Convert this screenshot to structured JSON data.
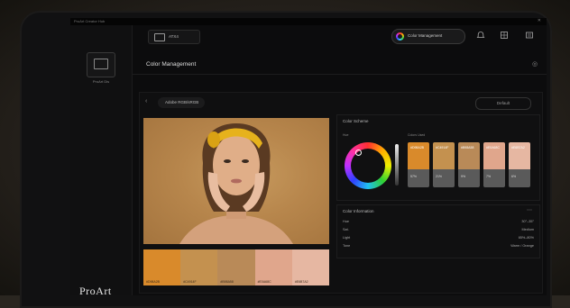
{
  "window": {
    "title": "ProArt Creator Hub",
    "close": "✕"
  },
  "sidebar": {
    "monitor_label": "ProArt Dis"
  },
  "header": {
    "device_label": "ATX4",
    "calibration_label": "Color Management",
    "icons": [
      "bell-icon",
      "grid-icon",
      "menu-icon"
    ]
  },
  "page": {
    "title": "Color Management",
    "title_icon": "◎"
  },
  "preset": {
    "tab_label": "Adobe RGB/sRGB",
    "button_label": "Default"
  },
  "palette_strip": [
    {
      "color": "#d98a2b",
      "label": "#D98A2B"
    },
    {
      "color": "#c4914f",
      "label": "#C4914F"
    },
    {
      "color": "#b98a58",
      "label": "#B98A58"
    },
    {
      "color": "#e0a68c",
      "label": "#E0A68C"
    },
    {
      "color": "#e6b7a2",
      "label": "#E6B7A2"
    }
  ],
  "color_card": {
    "title": "Color Scheme",
    "wheel_label": "Hue",
    "palette_label": "Colors Used",
    "swatches": [
      {
        "color": "#d98a2b",
        "label": "#D98A2B",
        "value": "57%"
      },
      {
        "color": "#c4914f",
        "label": "#C4914F",
        "value": "21%"
      },
      {
        "color": "#b98a58",
        "label": "#B98A58",
        "value": "9%"
      },
      {
        "color": "#e0a68c",
        "label": "#E0A68C",
        "value": "7%"
      },
      {
        "color": "#e6b7a2",
        "label": "#E6B7A2",
        "value": "6%"
      }
    ]
  },
  "info_card": {
    "title": "Color Information",
    "ctl": "⋯",
    "rows": [
      {
        "k": "Hue",
        "v": "30°–35°"
      },
      {
        "k": "Sat.",
        "v": "Medium"
      },
      {
        "k": "Light",
        "v": "65%–80%"
      },
      {
        "k": "Tone",
        "v": "Warm / Orange"
      }
    ]
  },
  "brand": "ProArt"
}
